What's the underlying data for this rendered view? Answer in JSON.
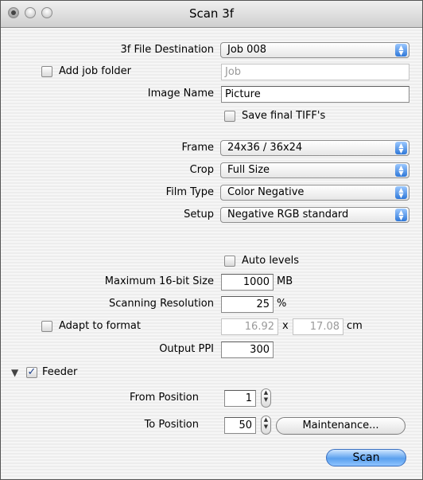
{
  "window": {
    "title": "Scan 3f"
  },
  "destination": {
    "label": "3f File Destination",
    "value": "Job 008"
  },
  "job_folder": {
    "label": "Add job folder",
    "checked": false,
    "field_value": "Job"
  },
  "image_name": {
    "label": "Image Name",
    "value": "Picture"
  },
  "save_tiff": {
    "label": "Save final TIFF's",
    "checked": false
  },
  "frame": {
    "label": "Frame",
    "value": "24x36 / 36x24"
  },
  "crop": {
    "label": "Crop",
    "value": "Full Size"
  },
  "film_type": {
    "label": "Film Type",
    "value": "Color Negative"
  },
  "setup": {
    "label": "Setup",
    "value": "Negative RGB standard"
  },
  "auto_levels": {
    "label": "Auto levels",
    "checked": false
  },
  "max_size": {
    "label": "Maximum 16-bit Size",
    "value": "1000",
    "unit": "MB"
  },
  "resolution": {
    "label": "Scanning Resolution",
    "value": "25",
    "unit": "%"
  },
  "adapt": {
    "label": "Adapt to format",
    "checked": false,
    "width": "16.92",
    "separator": "x",
    "height": "17.08",
    "unit": "cm"
  },
  "output_ppi": {
    "label": "Output PPI",
    "value": "300"
  },
  "feeder": {
    "label": "Feeder",
    "checked": true,
    "expanded": true
  },
  "from_position": {
    "label": "From Position",
    "value": "1"
  },
  "to_position": {
    "label": "To Position",
    "value": "50"
  },
  "buttons": {
    "maintenance": "Maintenance...",
    "scan": "Scan"
  }
}
